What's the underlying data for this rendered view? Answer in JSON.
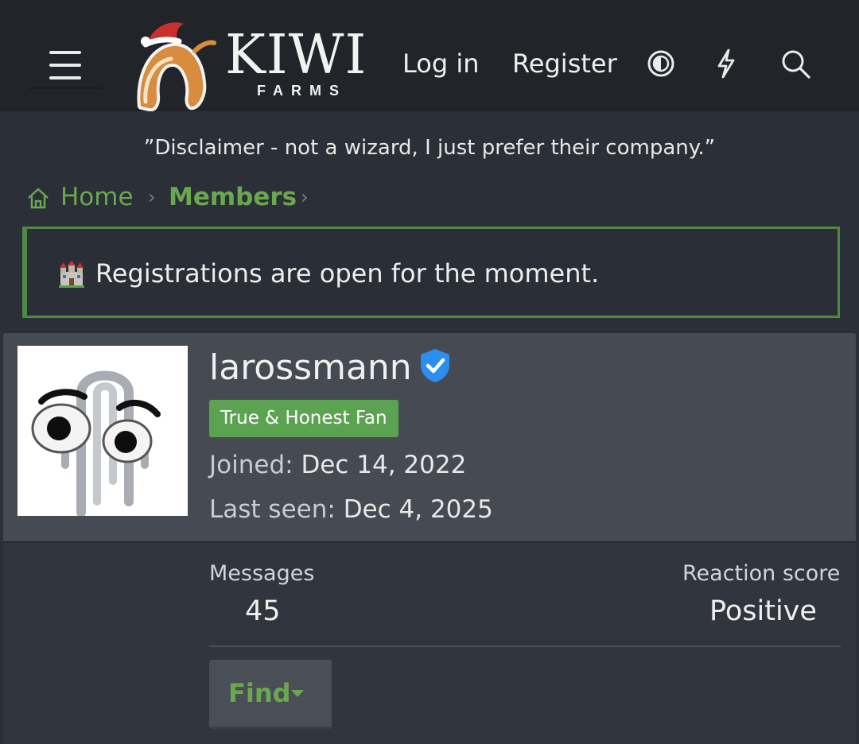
{
  "header": {
    "logo": {
      "title": "KIWI",
      "subtitle": "FARMS"
    },
    "nav": {
      "login": "Log in",
      "register": "Register"
    },
    "icons": [
      "menu-icon",
      "theme-toggle-icon",
      "whats-new-icon",
      "search-icon"
    ]
  },
  "disclaimer": "”Disclaimer - not a wizard, I just prefer their company.”",
  "breadcrumb": {
    "home": "Home",
    "members": "Members"
  },
  "notice": {
    "text": "Registrations are open for the moment."
  },
  "profile": {
    "username": "larossmann",
    "verified": true,
    "badge": "True & Honest Fan",
    "joined_label": "Joined:",
    "joined_value": "Dec 14, 2022",
    "last_seen_label": "Last seen:",
    "last_seen_value": "Dec 4, 2025",
    "stats": {
      "messages_label": "Messages",
      "messages_value": "45",
      "reaction_label": "Reaction score",
      "reaction_value": "Positive"
    },
    "find_label": "Find"
  },
  "colors": {
    "accent_green": "#6aa84f",
    "badge_green": "#5ca351",
    "verified_blue": "#2b8ef0",
    "header_bg": "#212429",
    "page_bg": "#2b2f38"
  }
}
